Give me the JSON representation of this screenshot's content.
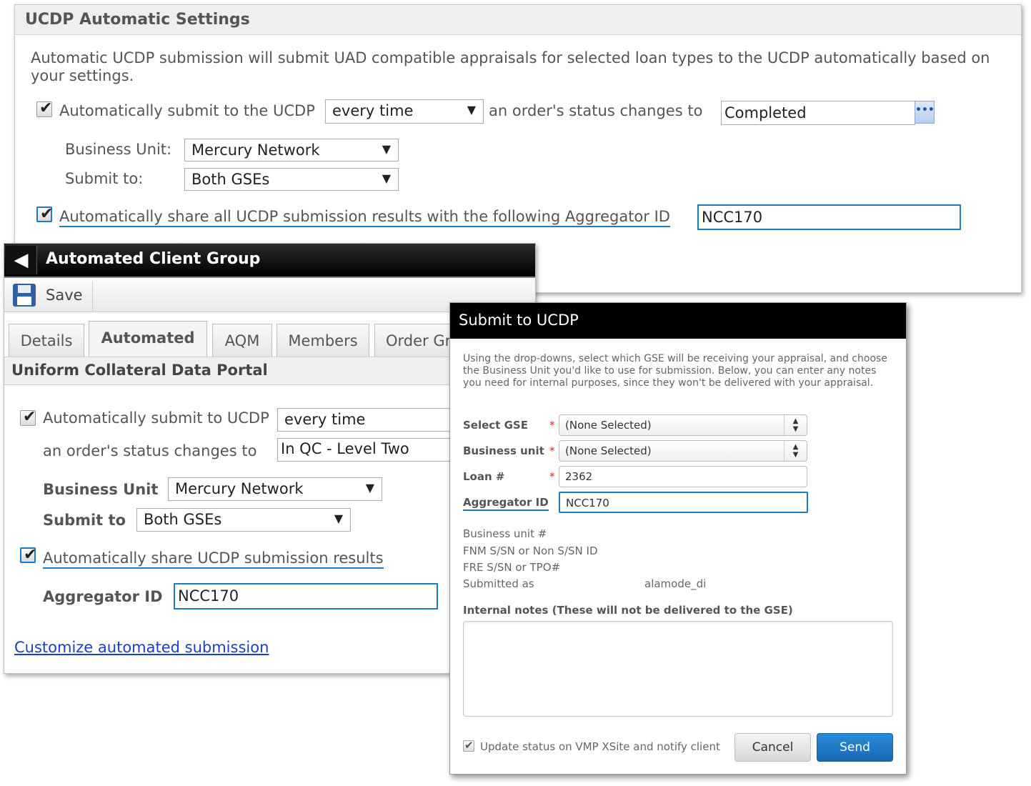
{
  "ucdp_settings": {
    "title": "UCDP Automatic Settings",
    "description": "Automatic UCDP submission will submit UAD compatible appraisals for selected loan types to the UCDP automatically based on your settings.",
    "auto_submit_label": "Automatically submit to the UCDP",
    "frequency_value": "every time",
    "status_change_label": "an order's status changes to",
    "status_value": "Completed",
    "ellipsis": "•••",
    "business_unit_label": "Business Unit:",
    "business_unit_value": "Mercury Network",
    "submit_to_label": "Submit to:",
    "submit_to_value": "Both GSEs",
    "share_label": "Automatically share all UCDP submission results with the following Aggregator ID",
    "aggregator_value": "NCC170"
  },
  "client_group": {
    "title": "Automated Client Group",
    "back_glyph": "◀",
    "save_label": "Save",
    "tabs": [
      {
        "label": "Details",
        "active": false
      },
      {
        "label": "Automated",
        "active": true
      },
      {
        "label": "AQM",
        "active": false
      },
      {
        "label": "Members",
        "active": false
      },
      {
        "label": "Order Gr",
        "active": false
      }
    ],
    "section_title": "Uniform Collateral Data Portal",
    "auto_submit_label": "Automatically submit to UCDP",
    "frequency_value": "every time",
    "status_change_label": "an order's status changes to",
    "status_value": "In QC - Level Two",
    "business_unit_label": "Business Unit",
    "business_unit_value": "Mercury Network",
    "submit_to_label": "Submit to",
    "submit_to_value": "Both GSEs",
    "share_label": "Automatically share UCDP submission results",
    "aggregator_label": "Aggregator ID",
    "aggregator_value": "NCC170",
    "customize_link": "Customize automated submission"
  },
  "submit_dialog": {
    "title": "Submit to UCDP",
    "description": "Using the drop-downs, select which GSE will be receiving your appraisal, and choose the Business Unit you'd like to use for submission. Below, you can enter any notes you need for internal purposes, since they won't be delivered with your appraisal.",
    "required_mark": "*",
    "select_gse_label": "Select GSE",
    "select_gse_value": "(None Selected)",
    "business_unit_label": "Business unit",
    "business_unit_value": "(None Selected)",
    "loan_label": "Loan #",
    "loan_value": "2362",
    "aggregator_label": "Aggregator ID",
    "aggregator_value": "NCC170",
    "business_unit_num_label": "Business unit #",
    "fnm_label": "FNM S/SN or Non S/SN ID",
    "fre_label": "FRE S/SN or TPO#",
    "submitted_as_label": "Submitted as",
    "submitted_as_value": "alamode_di",
    "notes_label": "Internal notes (These will not be delivered to the GSE)",
    "notes_value": "",
    "update_status_label": "Update status on VMP XSite and notify client",
    "cancel_label": "Cancel",
    "send_label": "Send"
  },
  "icons": {
    "check": "✔",
    "dropdown": "▼",
    "spinner_up": "▲",
    "spinner_down": "▼"
  },
  "colors": {
    "accent_blue": "#1a7cc4",
    "send_button": "#1769b5",
    "dialog_header": "#000000",
    "required": "#e2231a",
    "link": "#1a3fc4"
  }
}
